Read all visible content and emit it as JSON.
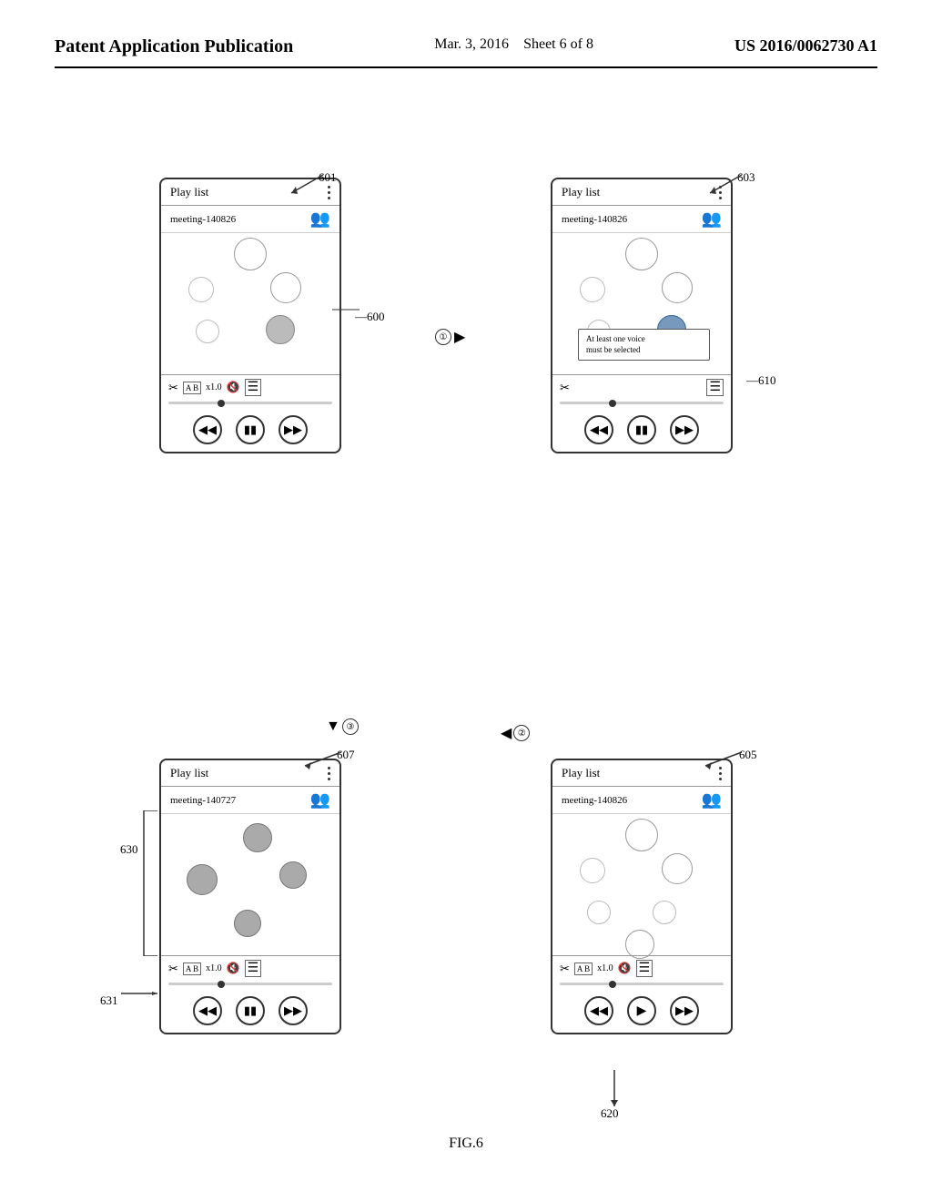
{
  "header": {
    "title": "Patent Application Publication",
    "date": "Mar. 3, 2016",
    "sheet": "Sheet 6 of 8",
    "number": "US 2016/0062730 A1"
  },
  "figure": {
    "label": "FIG.6",
    "phones": {
      "p601": {
        "id": "601",
        "title": "Play list",
        "meeting": "meeting-140826",
        "ref": "600"
      },
      "p603": {
        "id": "603",
        "title": "Play list",
        "meeting": "meeting-140826",
        "alert": "At least one voice\nmust be selected",
        "ref": "610"
      },
      "p607": {
        "id": "607",
        "title": "Play list",
        "meeting": "meeting-140727",
        "ref_bracket": "630",
        "ref_line": "631"
      },
      "p605": {
        "id": "605",
        "title": "Play list",
        "meeting": "meeting-140826",
        "ref": "620"
      }
    },
    "steps": {
      "step1": "①",
      "step2": "②",
      "step3": "③"
    },
    "toolbar": {
      "scissors": "✂",
      "ab": "A B",
      "speed": "x1.0",
      "volume": "🔇",
      "list": "≡"
    }
  }
}
